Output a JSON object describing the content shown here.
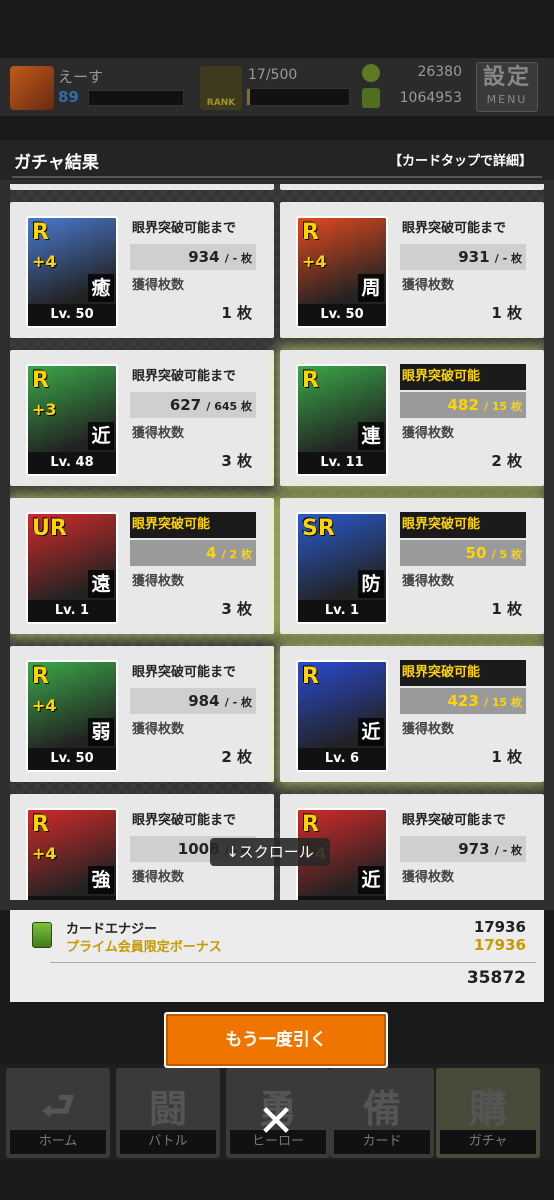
{
  "topbar": {
    "player_name": "えーす",
    "player_level": "89",
    "rank_label": "RANK",
    "rank_count": "17/500",
    "rank_progress": 0.034,
    "coins": "26380",
    "energy": "1064953",
    "menu_kanji": "設定",
    "menu_label": "MENU"
  },
  "panel": {
    "title": "ガチャ結果",
    "hint": "【カードタップで詳細】"
  },
  "labels": {
    "until_break": "眼界突破可能まで",
    "can_break": "眼界突破可能",
    "obtained": "獲得枚数"
  },
  "cards": [
    {
      "rarity": "R",
      "plus": "+4",
      "type": "癒",
      "level": "Lv. 50",
      "status": "until",
      "progress": "934",
      "limit": "/ - 枚",
      "count": "1 枚",
      "color": "#4a7ad0"
    },
    {
      "rarity": "R",
      "plus": "+4",
      "type": "周",
      "level": "Lv. 50",
      "status": "until",
      "progress": "931",
      "limit": "/ - 枚",
      "count": "1 枚",
      "color": "#e04a20"
    },
    {
      "rarity": "R",
      "plus": "+3",
      "type": "近",
      "level": "Lv. 48",
      "status": "until",
      "progress": "627",
      "limit": "/ 645 枚",
      "count": "3 枚",
      "color": "#3aa848"
    },
    {
      "rarity": "R",
      "plus": "",
      "type": "連",
      "level": "Lv. 11",
      "status": "can",
      "progress": "482",
      "limit": "/ 15 枚",
      "count": "2 枚",
      "color": "#3aa848"
    },
    {
      "rarity": "UR",
      "plus": "",
      "type": "遠",
      "level": "Lv. 1",
      "status": "can",
      "progress": "4",
      "limit": "/ 2 枚",
      "count": "3 枚",
      "color": "#d02a2a"
    },
    {
      "rarity": "SR",
      "plus": "",
      "type": "防",
      "level": "Lv. 1",
      "status": "can",
      "progress": "50",
      "limit": "/ 5 枚",
      "count": "1 枚",
      "color": "#2a5ad0"
    },
    {
      "rarity": "R",
      "plus": "+4",
      "type": "弱",
      "level": "Lv. 50",
      "status": "until",
      "progress": "984",
      "limit": "/ - 枚",
      "count": "2 枚",
      "color": "#3aa848"
    },
    {
      "rarity": "R",
      "plus": "",
      "type": "近",
      "level": "Lv. 6",
      "status": "can",
      "progress": "423",
      "limit": "/ 15 枚",
      "count": "1 枚",
      "color": "#2a4ad0"
    },
    {
      "rarity": "R",
      "plus": "+4",
      "type": "強",
      "level": "",
      "status": "until",
      "progress": "1008",
      "limit": "/ - 枚",
      "count": "",
      "color": "#d02a2a"
    },
    {
      "rarity": "R",
      "plus": "+4",
      "type": "近",
      "level": "",
      "status": "until",
      "progress": "973",
      "limit": "/ - 枚",
      "count": "",
      "color": "#d02a2a"
    }
  ],
  "scroll_tip": "↓スクロール",
  "summary": {
    "energy_label": "カードエナジー",
    "energy_value": "17936",
    "bonus_label": "プライム会員限定ボーナス",
    "bonus_value": "17936",
    "total": "35872"
  },
  "again_button": "もう一度引く",
  "nav": [
    {
      "kanji": "⮐",
      "label": "ホーム"
    },
    {
      "kanji": "闘",
      "label": "バトル"
    },
    {
      "kanji": "勇",
      "label": "ヒーロー"
    },
    {
      "kanji": "備",
      "label": "カード"
    },
    {
      "kanji": "購",
      "label": "ガチャ"
    }
  ],
  "close_symbol": "✕"
}
